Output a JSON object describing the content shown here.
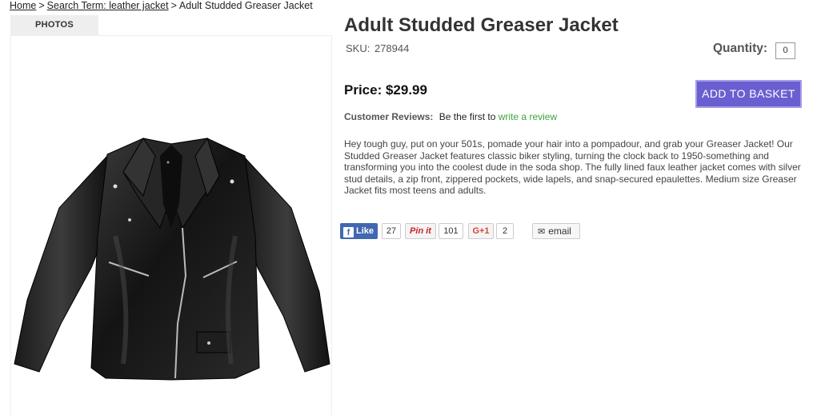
{
  "breadcrumb": {
    "home": "Home",
    "sep1": ">",
    "search": "Search Term: leather jacket",
    "sep2": ">",
    "current": "Adult Studded Greaser Jacket"
  },
  "photos": {
    "tab_label": "PHOTOS",
    "image_alt": "Adult Studded Greaser Jacket"
  },
  "product": {
    "title": "Adult Studded Greaser Jacket",
    "sku_label": "SKU:",
    "sku": "278944",
    "quantity_label": "Quantity:",
    "quantity_value": "0",
    "price": "Price: $29.99",
    "add_button": "ADD TO BASKET",
    "reviews_label": "Customer Reviews:",
    "reviews_text": "Be the first to",
    "reviews_link": "write a review",
    "description": "Hey tough guy, put on your 501s, pomade your hair into a pompadour, and grab your Greaser Jacket! Our Studded Greaser Jacket features classic biker styling, turning the clock back to 1950-something and transforming you into the coolest dude in the soda shop. The fully lined faux leather jacket comes with silver stud details, a zip front, zippered pockets, wide lapels, and snap-secured epaulettes. Medium size Greaser Jacket fits most teens and adults."
  },
  "social": {
    "facebook_label": "Like",
    "facebook_icon": "f",
    "facebook_count": "27",
    "pinterest_label": "Pin it",
    "pinterest_count": "101",
    "gplus_label": "G+1",
    "gplus_count": "2",
    "email_label": "email",
    "email_icon": "✉"
  },
  "colors": {
    "accent_button": "#6a5fd0",
    "review_link": "#3aa53a",
    "facebook": "#4267b2",
    "pinterest": "#cb2027"
  }
}
